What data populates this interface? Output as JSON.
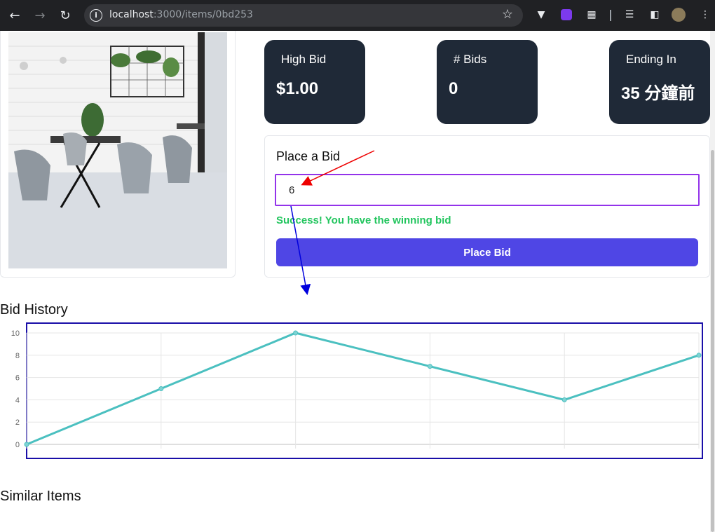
{
  "browser": {
    "url_host": "localhost",
    "url_path": ":3000/items/0bd253",
    "icons": [
      "back-arrow-icon",
      "forward-arrow-icon",
      "reload-icon",
      "site-info-icon",
      "bookmark-star-icon",
      "extension-v-icon",
      "extension-purple-icon",
      "extensions-puzzle-icon",
      "media-queue-icon",
      "side-panel-icon",
      "profile-avatar-icon",
      "kebab-menu-icon"
    ]
  },
  "stats": {
    "high_bid_label": "High Bid",
    "high_bid_value": "$1.00",
    "bids_label": "# Bids",
    "bids_value": "0",
    "ending_label": "Ending In",
    "ending_value": "35 分鐘前"
  },
  "bid_form": {
    "title": "Place a Bid",
    "input_value": "6",
    "success_message": "Success! You have the winning bid",
    "button_label": "Place Bid"
  },
  "sections": {
    "bid_history": "Bid History",
    "similar_items": "Similar Items"
  },
  "colors": {
    "stat_card_bg": "#1f2937",
    "button_bg": "#4f46e5",
    "success": "#22c55e",
    "input_border": "#9333ea",
    "line": "#4bc0c0"
  },
  "chart_data": {
    "type": "line",
    "x": [
      1,
      2,
      3,
      4,
      5,
      6
    ],
    "series": [
      {
        "values": [
          0,
          5,
          10,
          7,
          4,
          8
        ]
      }
    ],
    "ylim": [
      0,
      10
    ],
    "yticks": [
      0,
      2,
      4,
      6,
      8,
      10
    ],
    "grid": true,
    "title": "",
    "xlabel": "",
    "ylabel": ""
  }
}
